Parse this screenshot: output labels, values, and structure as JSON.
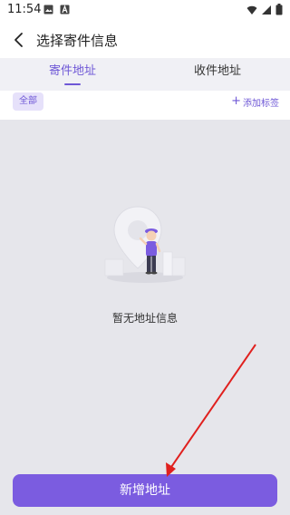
{
  "status_bar": {
    "time": "11:54",
    "left_icons": [
      "image-icon",
      "a-icon"
    ],
    "right_icons": [
      "wifi-icon",
      "signal-icon",
      "battery-icon"
    ]
  },
  "header": {
    "title": "选择寄件信息",
    "back_icon": "back-arrow-icon"
  },
  "tabs": [
    {
      "label": "寄件地址",
      "active": true
    },
    {
      "label": "收件地址",
      "active": false
    }
  ],
  "filter": {
    "chip_label": "全部",
    "add_tag_label": "添加标签"
  },
  "empty_state": {
    "text": "暂无地址信息",
    "illustration": "empty-address-illustration"
  },
  "bottom_button": {
    "label": "新增地址"
  },
  "colors": {
    "accent": "#6e57d6",
    "button": "#7b5ce0",
    "annotation": "#e0201e"
  }
}
